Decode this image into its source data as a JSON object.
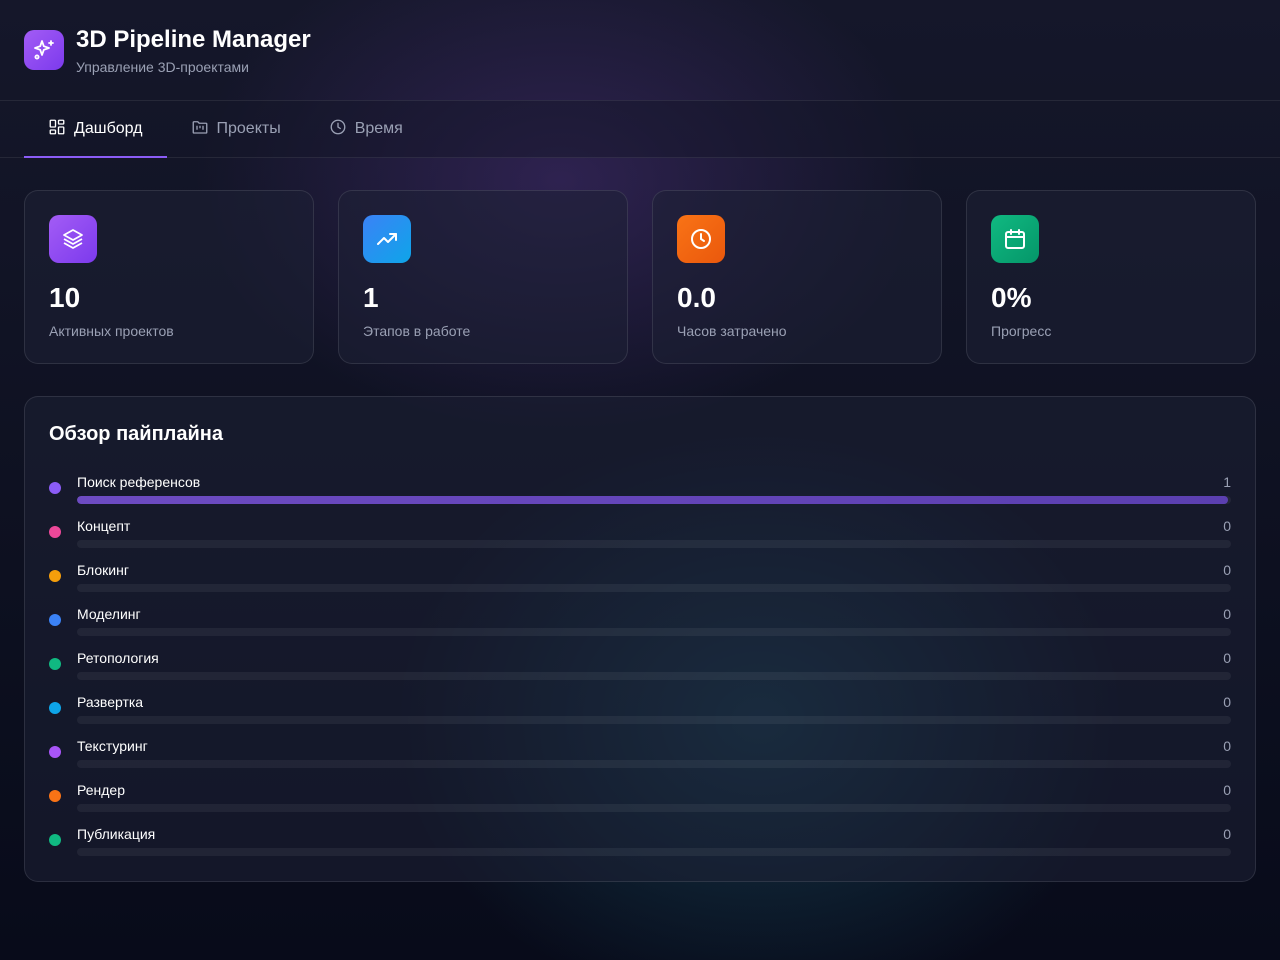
{
  "header": {
    "title": "3D Pipeline Manager",
    "subtitle": "Управление 3D-проектами",
    "logo_icon": "sparkles-icon"
  },
  "tabs": [
    {
      "label": "Дашборд",
      "icon": "dashboard-icon",
      "active": true
    },
    {
      "label": "Проекты",
      "icon": "folder-icon",
      "active": false
    },
    {
      "label": "Время",
      "icon": "clock-icon",
      "active": false
    }
  ],
  "stats": [
    {
      "value": "10",
      "label": "Активных проектов",
      "icon": "layers-icon",
      "color": "#8b5cf6"
    },
    {
      "value": "1",
      "label": "Этапов в работе",
      "icon": "trending-up-icon",
      "color": "#3b82f6"
    },
    {
      "value": "0.0",
      "label": "Часов затрачено",
      "icon": "clock-icon",
      "color": "#f97316"
    },
    {
      "value": "0%",
      "label": "Прогресс",
      "icon": "calendar-icon",
      "color": "#10b981"
    }
  ],
  "pipeline": {
    "title": "Обзор пайплайна",
    "stages": [
      {
        "name": "Поиск референсов",
        "count": "1",
        "fill": 1.0,
        "color": "#8b5cf6"
      },
      {
        "name": "Концепт",
        "count": "0",
        "fill": 0,
        "color": "#ec4899"
      },
      {
        "name": "Блокинг",
        "count": "0",
        "fill": 0,
        "color": "#f59e0b"
      },
      {
        "name": "Моделинг",
        "count": "0",
        "fill": 0,
        "color": "#3b82f6"
      },
      {
        "name": "Ретопология",
        "count": "0",
        "fill": 0,
        "color": "#10b981"
      },
      {
        "name": "Развертка",
        "count": "0",
        "fill": 0,
        "color": "#0ea5e9"
      },
      {
        "name": "Текстуринг",
        "count": "0",
        "fill": 0,
        "color": "#a855f7"
      },
      {
        "name": "Рендер",
        "count": "0",
        "fill": 0,
        "color": "#f97316"
      },
      {
        "name": "Публикация",
        "count": "0",
        "fill": 0,
        "color": "#10b981"
      }
    ]
  }
}
